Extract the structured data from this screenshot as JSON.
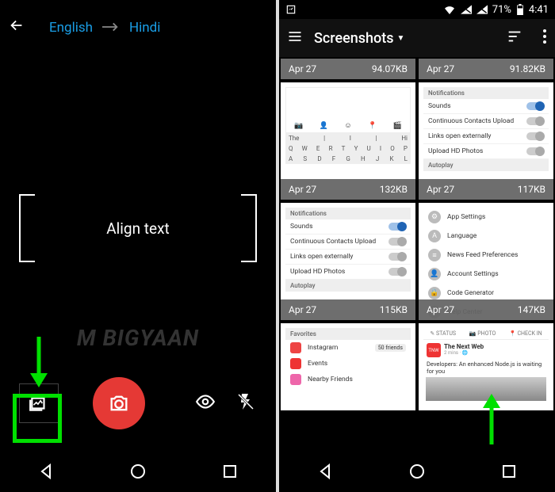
{
  "left": {
    "source_lang": "English",
    "target_lang": "Hindi",
    "align_label": "Align text"
  },
  "watermark": "M    BIGYAAN",
  "right": {
    "status": {
      "battery": "71%",
      "time": "4:41"
    },
    "toolbar": {
      "title": "Screenshots"
    },
    "thumbs": [
      {
        "date": "Apr 27",
        "size": "94.07KB"
      },
      {
        "date": "Apr 27",
        "size": "91.82KB"
      },
      {
        "date": "Apr 27",
        "size": "132KB"
      },
      {
        "date": "Apr 27",
        "size": "117KB"
      },
      {
        "date": "Apr 27",
        "size": "115KB"
      },
      {
        "date": "Apr 27",
        "size": "147KB"
      }
    ],
    "settings": {
      "header1": "Notifications",
      "sounds": "Sounds",
      "contacts": "Continuous Contacts Upload",
      "links": "Links open externally",
      "hd": "Upload HD Photos",
      "header2": "Autoplay"
    },
    "acct": {
      "app": "App Settings",
      "lang": "Language",
      "news": "News Feed Preferences",
      "acct": "Account Settings",
      "code": "Code Generator",
      "help": "Help Center"
    },
    "fav": {
      "header": "Favorites",
      "ig": "Instagram",
      "ig_badge": "50 friends",
      "events": "Events",
      "nearby": "Nearby Friends"
    },
    "feed": {
      "status": "STATUS",
      "photo": "PHOTO",
      "checkin": "CHECK IN",
      "tnw": "The Next Web",
      "headline": "Developers: An enhanced Node.js is waiting for you"
    },
    "kbd": {
      "suggestions": [
        "The",
        "I",
        "Hi"
      ],
      "row": [
        "Q",
        "W",
        "E",
        "R",
        "T",
        "Y",
        "U",
        "I",
        "O",
        "P"
      ],
      "row2": [
        "A",
        "S",
        "D",
        "F",
        "G",
        "H",
        "J",
        "K",
        "L"
      ]
    }
  }
}
